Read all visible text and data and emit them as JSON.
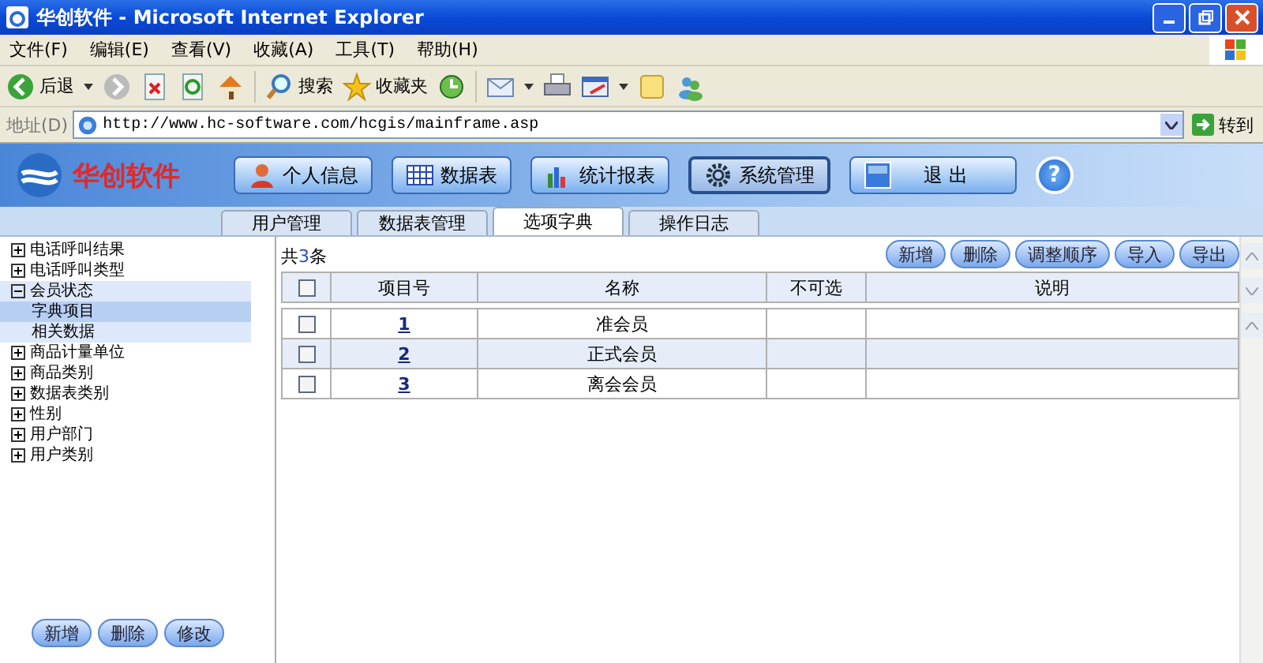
{
  "window": {
    "title": "华创软件 - Microsoft Internet Explorer"
  },
  "menu": [
    "文件(F)",
    "编辑(E)",
    "查看(V)",
    "收藏(A)",
    "工具(T)",
    "帮助(H)"
  ],
  "toolbar": {
    "back": "后退",
    "search": "搜索",
    "favorites": "收藏夹"
  },
  "address": {
    "label": "地址(D)",
    "value": "http://www.hc-software.com/hcgis/mainframe.asp",
    "go": "转到"
  },
  "app": {
    "brand": "华创软件",
    "nav": [
      {
        "label": "个人信息",
        "kind": "person",
        "selected": false
      },
      {
        "label": "数据表",
        "kind": "grid",
        "selected": false
      },
      {
        "label": "统计报表",
        "kind": "chart",
        "selected": false
      },
      {
        "label": "系统管理",
        "kind": "gear",
        "selected": true
      },
      {
        "label": "退 出",
        "kind": "exit",
        "selected": false
      }
    ],
    "help": "?",
    "tabs": [
      {
        "label": "用户管理",
        "selected": false
      },
      {
        "label": "数据表管理",
        "selected": false
      },
      {
        "label": "选项字典",
        "selected": true
      },
      {
        "label": "操作日志",
        "selected": false
      }
    ]
  },
  "sidebar": {
    "tree": [
      {
        "label": "电话呼叫结果",
        "expanded": false,
        "selected": false
      },
      {
        "label": "电话呼叫类型",
        "expanded": false,
        "selected": false
      },
      {
        "label": "会员状态",
        "expanded": true,
        "selected": false,
        "children": [
          {
            "label": "字典项目",
            "selected": true
          },
          {
            "label": "相关数据",
            "selected": false
          }
        ]
      },
      {
        "label": "商品计量单位",
        "expanded": false,
        "selected": false
      },
      {
        "label": "商品类别",
        "expanded": false,
        "selected": false
      },
      {
        "label": "数据表类别",
        "expanded": false,
        "selected": false
      },
      {
        "label": "性别",
        "expanded": false,
        "selected": false
      },
      {
        "label": "用户部门",
        "expanded": false,
        "selected": false
      },
      {
        "label": "用户类别",
        "expanded": false,
        "selected": false
      }
    ],
    "buttons": [
      "新增",
      "删除",
      "修改"
    ]
  },
  "content": {
    "record_count": {
      "prefix": "共",
      "count": "3",
      "suffix": "条"
    },
    "actions": [
      "新增",
      "删除",
      "调整顺序",
      "导入",
      "导出"
    ],
    "table": {
      "columns": [
        "项目号",
        "名称",
        "不可选",
        "说明"
      ],
      "header_checked": false,
      "rows": [
        {
          "checked": false,
          "number": "1",
          "name": "准会员"
        },
        {
          "checked": false,
          "number": "2",
          "name": "正式会员"
        },
        {
          "checked": false,
          "number": "3",
          "name": "离会会员"
        }
      ]
    }
  }
}
